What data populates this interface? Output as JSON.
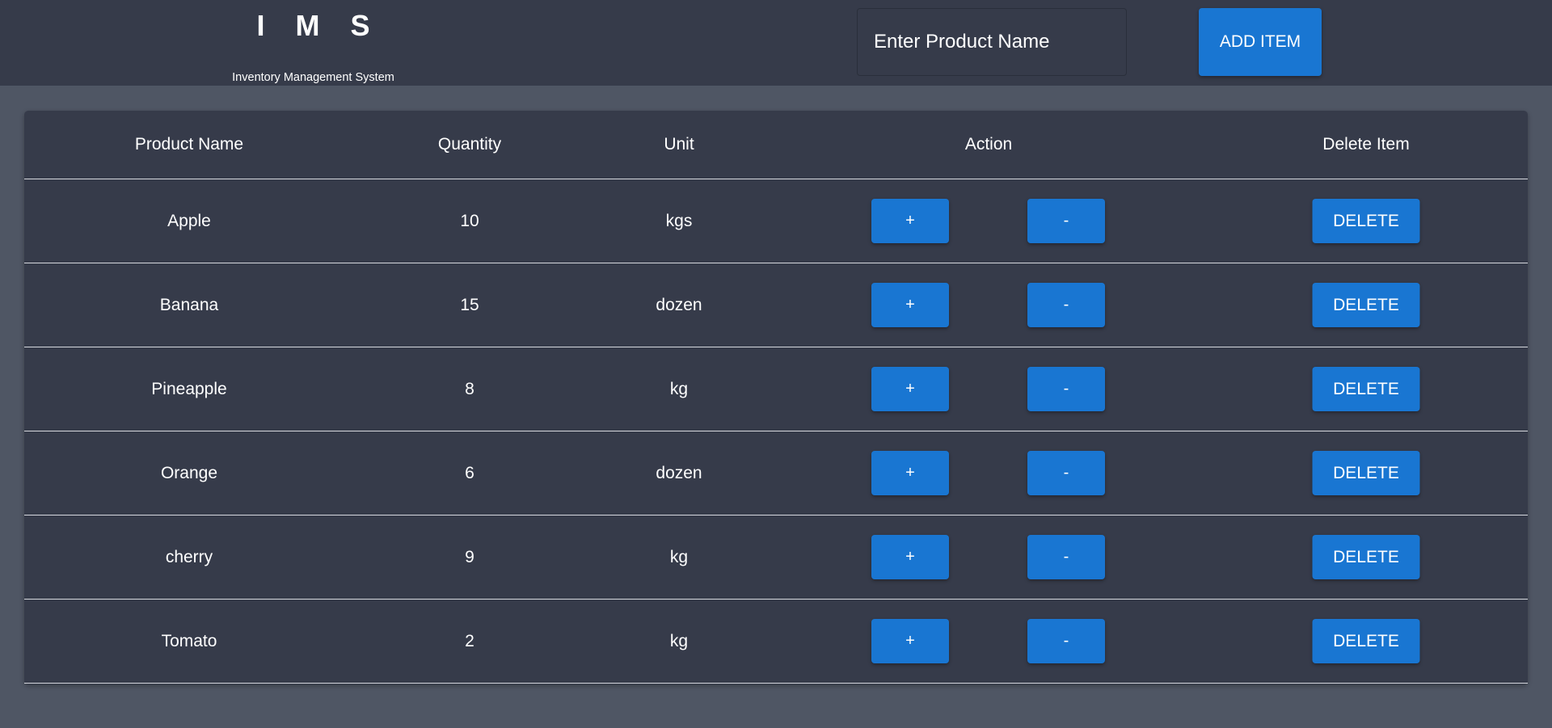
{
  "header": {
    "logo_title": "I M S",
    "logo_subtitle": "Inventory Management System",
    "search_placeholder": "Enter Product Name",
    "add_button_label": "ADD ITEM"
  },
  "table": {
    "columns": [
      "Product Name",
      "Quantity",
      "Unit",
      "Action",
      "Delete Item"
    ],
    "rows": [
      {
        "name": "Apple",
        "quantity": "10",
        "unit": "kgs"
      },
      {
        "name": "Banana",
        "quantity": "15",
        "unit": "dozen"
      },
      {
        "name": "Pineapple",
        "quantity": "8",
        "unit": "kg"
      },
      {
        "name": "Orange",
        "quantity": "6",
        "unit": "dozen"
      },
      {
        "name": "cherry",
        "quantity": "9",
        "unit": "kg"
      },
      {
        "name": "Tomato",
        "quantity": "2",
        "unit": "kg"
      }
    ],
    "increment_label": "+",
    "decrement_label": "-",
    "delete_label": "DELETE"
  },
  "colors": {
    "page_background": "#4f5664",
    "panel_background": "#363b4a",
    "accent": "#1976d2",
    "row_divider": "#d6d8de"
  }
}
